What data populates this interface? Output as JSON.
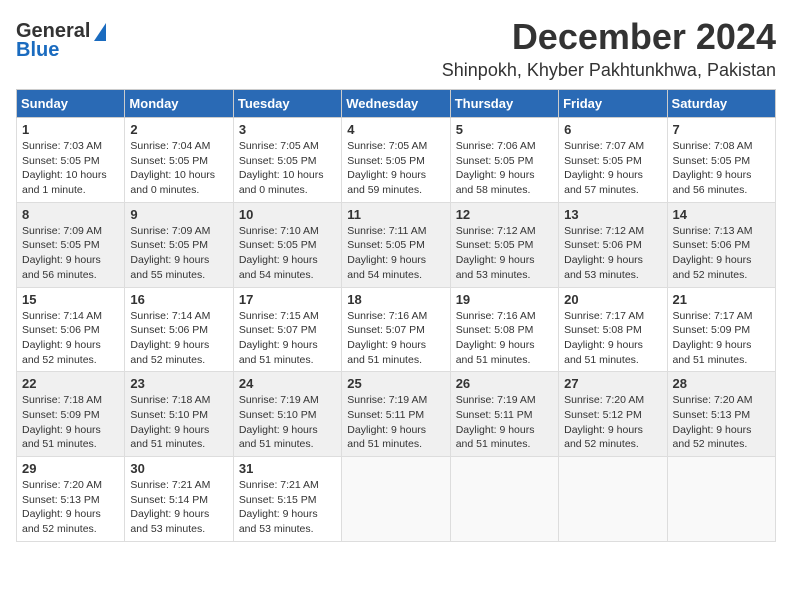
{
  "header": {
    "logo_general": "General",
    "logo_blue": "Blue",
    "month_title": "December 2024",
    "location": "Shinpokh, Khyber Pakhtunkhwa, Pakistan"
  },
  "calendar": {
    "days_of_week": [
      "Sunday",
      "Monday",
      "Tuesday",
      "Wednesday",
      "Thursday",
      "Friday",
      "Saturday"
    ],
    "weeks": [
      [
        {
          "day": "",
          "info": ""
        },
        {
          "day": "2",
          "info": "Sunrise: 7:04 AM\nSunset: 5:05 PM\nDaylight: 10 hours\nand 0 minutes."
        },
        {
          "day": "3",
          "info": "Sunrise: 7:05 AM\nSunset: 5:05 PM\nDaylight: 10 hours\nand 0 minutes."
        },
        {
          "day": "4",
          "info": "Sunrise: 7:05 AM\nSunset: 5:05 PM\nDaylight: 9 hours\nand 59 minutes."
        },
        {
          "day": "5",
          "info": "Sunrise: 7:06 AM\nSunset: 5:05 PM\nDaylight: 9 hours\nand 58 minutes."
        },
        {
          "day": "6",
          "info": "Sunrise: 7:07 AM\nSunset: 5:05 PM\nDaylight: 9 hours\nand 57 minutes."
        },
        {
          "day": "7",
          "info": "Sunrise: 7:08 AM\nSunset: 5:05 PM\nDaylight: 9 hours\nand 56 minutes."
        }
      ],
      [
        {
          "day": "8",
          "info": "Sunrise: 7:09 AM\nSunset: 5:05 PM\nDaylight: 9 hours\nand 56 minutes."
        },
        {
          "day": "9",
          "info": "Sunrise: 7:09 AM\nSunset: 5:05 PM\nDaylight: 9 hours\nand 55 minutes."
        },
        {
          "day": "10",
          "info": "Sunrise: 7:10 AM\nSunset: 5:05 PM\nDaylight: 9 hours\nand 54 minutes."
        },
        {
          "day": "11",
          "info": "Sunrise: 7:11 AM\nSunset: 5:05 PM\nDaylight: 9 hours\nand 54 minutes."
        },
        {
          "day": "12",
          "info": "Sunrise: 7:12 AM\nSunset: 5:05 PM\nDaylight: 9 hours\nand 53 minutes."
        },
        {
          "day": "13",
          "info": "Sunrise: 7:12 AM\nSunset: 5:06 PM\nDaylight: 9 hours\nand 53 minutes."
        },
        {
          "day": "14",
          "info": "Sunrise: 7:13 AM\nSunset: 5:06 PM\nDaylight: 9 hours\nand 52 minutes."
        }
      ],
      [
        {
          "day": "15",
          "info": "Sunrise: 7:14 AM\nSunset: 5:06 PM\nDaylight: 9 hours\nand 52 minutes."
        },
        {
          "day": "16",
          "info": "Sunrise: 7:14 AM\nSunset: 5:06 PM\nDaylight: 9 hours\nand 52 minutes."
        },
        {
          "day": "17",
          "info": "Sunrise: 7:15 AM\nSunset: 5:07 PM\nDaylight: 9 hours\nand 51 minutes."
        },
        {
          "day": "18",
          "info": "Sunrise: 7:16 AM\nSunset: 5:07 PM\nDaylight: 9 hours\nand 51 minutes."
        },
        {
          "day": "19",
          "info": "Sunrise: 7:16 AM\nSunset: 5:08 PM\nDaylight: 9 hours\nand 51 minutes."
        },
        {
          "day": "20",
          "info": "Sunrise: 7:17 AM\nSunset: 5:08 PM\nDaylight: 9 hours\nand 51 minutes."
        },
        {
          "day": "21",
          "info": "Sunrise: 7:17 AM\nSunset: 5:09 PM\nDaylight: 9 hours\nand 51 minutes."
        }
      ],
      [
        {
          "day": "22",
          "info": "Sunrise: 7:18 AM\nSunset: 5:09 PM\nDaylight: 9 hours\nand 51 minutes."
        },
        {
          "day": "23",
          "info": "Sunrise: 7:18 AM\nSunset: 5:10 PM\nDaylight: 9 hours\nand 51 minutes."
        },
        {
          "day": "24",
          "info": "Sunrise: 7:19 AM\nSunset: 5:10 PM\nDaylight: 9 hours\nand 51 minutes."
        },
        {
          "day": "25",
          "info": "Sunrise: 7:19 AM\nSunset: 5:11 PM\nDaylight: 9 hours\nand 51 minutes."
        },
        {
          "day": "26",
          "info": "Sunrise: 7:19 AM\nSunset: 5:11 PM\nDaylight: 9 hours\nand 51 minutes."
        },
        {
          "day": "27",
          "info": "Sunrise: 7:20 AM\nSunset: 5:12 PM\nDaylight: 9 hours\nand 52 minutes."
        },
        {
          "day": "28",
          "info": "Sunrise: 7:20 AM\nSunset: 5:13 PM\nDaylight: 9 hours\nand 52 minutes."
        }
      ],
      [
        {
          "day": "29",
          "info": "Sunrise: 7:20 AM\nSunset: 5:13 PM\nDaylight: 9 hours\nand 52 minutes."
        },
        {
          "day": "30",
          "info": "Sunrise: 7:21 AM\nSunset: 5:14 PM\nDaylight: 9 hours\nand 53 minutes."
        },
        {
          "day": "31",
          "info": "Sunrise: 7:21 AM\nSunset: 5:15 PM\nDaylight: 9 hours\nand 53 minutes."
        },
        {
          "day": "",
          "info": ""
        },
        {
          "day": "",
          "info": ""
        },
        {
          "day": "",
          "info": ""
        },
        {
          "day": "",
          "info": ""
        }
      ]
    ],
    "first_week_special": {
      "day": "1",
      "info": "Sunrise: 7:03 AM\nSunset: 5:05 PM\nDaylight: 10 hours\nand 1 minute."
    }
  }
}
